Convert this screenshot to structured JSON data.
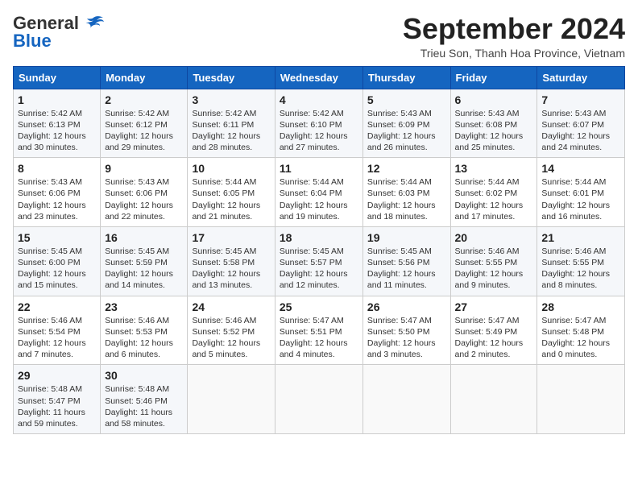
{
  "header": {
    "logo_general": "General",
    "logo_blue": "Blue",
    "month_title": "September 2024",
    "subtitle": "Trieu Son, Thanh Hoa Province, Vietnam"
  },
  "weekdays": [
    "Sunday",
    "Monday",
    "Tuesday",
    "Wednesday",
    "Thursday",
    "Friday",
    "Saturday"
  ],
  "weeks": [
    [
      {
        "day": "1",
        "sunrise": "Sunrise: 5:42 AM",
        "sunset": "Sunset: 6:13 PM",
        "daylight": "Daylight: 12 hours and 30 minutes."
      },
      {
        "day": "2",
        "sunrise": "Sunrise: 5:42 AM",
        "sunset": "Sunset: 6:12 PM",
        "daylight": "Daylight: 12 hours and 29 minutes."
      },
      {
        "day": "3",
        "sunrise": "Sunrise: 5:42 AM",
        "sunset": "Sunset: 6:11 PM",
        "daylight": "Daylight: 12 hours and 28 minutes."
      },
      {
        "day": "4",
        "sunrise": "Sunrise: 5:42 AM",
        "sunset": "Sunset: 6:10 PM",
        "daylight": "Daylight: 12 hours and 27 minutes."
      },
      {
        "day": "5",
        "sunrise": "Sunrise: 5:43 AM",
        "sunset": "Sunset: 6:09 PM",
        "daylight": "Daylight: 12 hours and 26 minutes."
      },
      {
        "day": "6",
        "sunrise": "Sunrise: 5:43 AM",
        "sunset": "Sunset: 6:08 PM",
        "daylight": "Daylight: 12 hours and 25 minutes."
      },
      {
        "day": "7",
        "sunrise": "Sunrise: 5:43 AM",
        "sunset": "Sunset: 6:07 PM",
        "daylight": "Daylight: 12 hours and 24 minutes."
      }
    ],
    [
      {
        "day": "8",
        "sunrise": "Sunrise: 5:43 AM",
        "sunset": "Sunset: 6:06 PM",
        "daylight": "Daylight: 12 hours and 23 minutes."
      },
      {
        "day": "9",
        "sunrise": "Sunrise: 5:43 AM",
        "sunset": "Sunset: 6:06 PM",
        "daylight": "Daylight: 12 hours and 22 minutes."
      },
      {
        "day": "10",
        "sunrise": "Sunrise: 5:44 AM",
        "sunset": "Sunset: 6:05 PM",
        "daylight": "Daylight: 12 hours and 21 minutes."
      },
      {
        "day": "11",
        "sunrise": "Sunrise: 5:44 AM",
        "sunset": "Sunset: 6:04 PM",
        "daylight": "Daylight: 12 hours and 19 minutes."
      },
      {
        "day": "12",
        "sunrise": "Sunrise: 5:44 AM",
        "sunset": "Sunset: 6:03 PM",
        "daylight": "Daylight: 12 hours and 18 minutes."
      },
      {
        "day": "13",
        "sunrise": "Sunrise: 5:44 AM",
        "sunset": "Sunset: 6:02 PM",
        "daylight": "Daylight: 12 hours and 17 minutes."
      },
      {
        "day": "14",
        "sunrise": "Sunrise: 5:44 AM",
        "sunset": "Sunset: 6:01 PM",
        "daylight": "Daylight: 12 hours and 16 minutes."
      }
    ],
    [
      {
        "day": "15",
        "sunrise": "Sunrise: 5:45 AM",
        "sunset": "Sunset: 6:00 PM",
        "daylight": "Daylight: 12 hours and 15 minutes."
      },
      {
        "day": "16",
        "sunrise": "Sunrise: 5:45 AM",
        "sunset": "Sunset: 5:59 PM",
        "daylight": "Daylight: 12 hours and 14 minutes."
      },
      {
        "day": "17",
        "sunrise": "Sunrise: 5:45 AM",
        "sunset": "Sunset: 5:58 PM",
        "daylight": "Daylight: 12 hours and 13 minutes."
      },
      {
        "day": "18",
        "sunrise": "Sunrise: 5:45 AM",
        "sunset": "Sunset: 5:57 PM",
        "daylight": "Daylight: 12 hours and 12 minutes."
      },
      {
        "day": "19",
        "sunrise": "Sunrise: 5:45 AM",
        "sunset": "Sunset: 5:56 PM",
        "daylight": "Daylight: 12 hours and 11 minutes."
      },
      {
        "day": "20",
        "sunrise": "Sunrise: 5:46 AM",
        "sunset": "Sunset: 5:55 PM",
        "daylight": "Daylight: 12 hours and 9 minutes."
      },
      {
        "day": "21",
        "sunrise": "Sunrise: 5:46 AM",
        "sunset": "Sunset: 5:55 PM",
        "daylight": "Daylight: 12 hours and 8 minutes."
      }
    ],
    [
      {
        "day": "22",
        "sunrise": "Sunrise: 5:46 AM",
        "sunset": "Sunset: 5:54 PM",
        "daylight": "Daylight: 12 hours and 7 minutes."
      },
      {
        "day": "23",
        "sunrise": "Sunrise: 5:46 AM",
        "sunset": "Sunset: 5:53 PM",
        "daylight": "Daylight: 12 hours and 6 minutes."
      },
      {
        "day": "24",
        "sunrise": "Sunrise: 5:46 AM",
        "sunset": "Sunset: 5:52 PM",
        "daylight": "Daylight: 12 hours and 5 minutes."
      },
      {
        "day": "25",
        "sunrise": "Sunrise: 5:47 AM",
        "sunset": "Sunset: 5:51 PM",
        "daylight": "Daylight: 12 hours and 4 minutes."
      },
      {
        "day": "26",
        "sunrise": "Sunrise: 5:47 AM",
        "sunset": "Sunset: 5:50 PM",
        "daylight": "Daylight: 12 hours and 3 minutes."
      },
      {
        "day": "27",
        "sunrise": "Sunrise: 5:47 AM",
        "sunset": "Sunset: 5:49 PM",
        "daylight": "Daylight: 12 hours and 2 minutes."
      },
      {
        "day": "28",
        "sunrise": "Sunrise: 5:47 AM",
        "sunset": "Sunset: 5:48 PM",
        "daylight": "Daylight: 12 hours and 0 minutes."
      }
    ],
    [
      {
        "day": "29",
        "sunrise": "Sunrise: 5:48 AM",
        "sunset": "Sunset: 5:47 PM",
        "daylight": "Daylight: 11 hours and 59 minutes."
      },
      {
        "day": "30",
        "sunrise": "Sunrise: 5:48 AM",
        "sunset": "Sunset: 5:46 PM",
        "daylight": "Daylight: 11 hours and 58 minutes."
      },
      null,
      null,
      null,
      null,
      null
    ]
  ]
}
